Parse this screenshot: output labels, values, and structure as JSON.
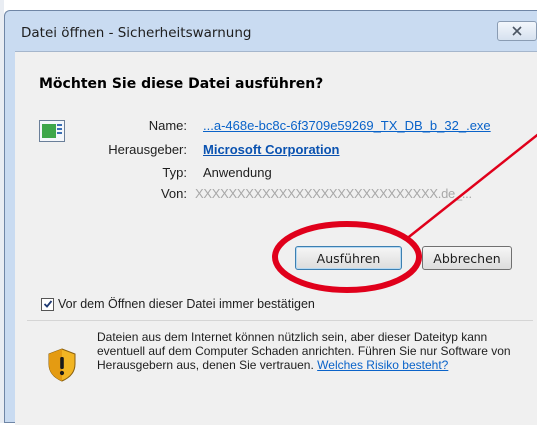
{
  "window": {
    "title": "Datei öffnen - Sicherheitswarnung"
  },
  "dialog": {
    "question": "Möchten Sie diese Datei ausführen?",
    "fields": {
      "name_label": "Name:",
      "name_value": "...a-468e-bc8c-6f3709e59269_TX_DB_b_32_.exe",
      "publisher_label": "Herausgeber:",
      "publisher_value": "Microsoft Corporation",
      "type_label": "Typ:",
      "type_value": "Anwendung",
      "from_label": "Von:",
      "from_value": "XXXXXXXXXXXXXXXXXXXXXXXXXXXXX.de_..."
    },
    "buttons": {
      "run": "Ausführen",
      "cancel": "Abbrechen"
    },
    "checkbox": {
      "label": "Vor dem Öffnen dieser Datei immer bestätigen",
      "checked": true
    },
    "info": {
      "text": "Dateien aus dem Internet können nützlich sein, aber dieser Dateityp kann eventuell auf dem Computer Schaden anrichten. Führen Sie nur Software von Herausgebern aus, denen Sie vertrauen.",
      "link": "Welches Risiko besteht?"
    }
  },
  "colors": {
    "annotation": "#e0001b",
    "link": "#0a63c9",
    "titlebar": "#c9dbf1"
  },
  "icons": [
    "close-icon",
    "file-icon",
    "checkmark-icon",
    "shield-warning-icon"
  ]
}
